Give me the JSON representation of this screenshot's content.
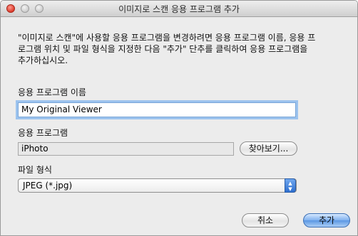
{
  "window": {
    "title": "이미지로 스캔 응용 프로그램 추가"
  },
  "description": {
    "lines": [
      "\"이미지로 스캔\"에 사용할 응용 프로그램을 변경하려면 응용 프로그램 이름, 응용 프",
      "로그램 위치 및 파일 형식을 지정한 다음 \"추가\" 단추를 클릭하여 응용 프로그램을",
      "추가하십시오."
    ]
  },
  "app_name": {
    "label": "응용 프로그램 이름",
    "value": "My Original Viewer"
  },
  "application": {
    "label": "응용 프로그램",
    "value": "iPhoto",
    "browse_label": "찾아보기..."
  },
  "file_format": {
    "label": "파일 형식",
    "selected": "JPEG (*.jpg)"
  },
  "buttons": {
    "cancel": "취소",
    "add": "추가"
  },
  "colors": {
    "accent": "#5a97e3",
    "close": "#dd3b2b"
  }
}
